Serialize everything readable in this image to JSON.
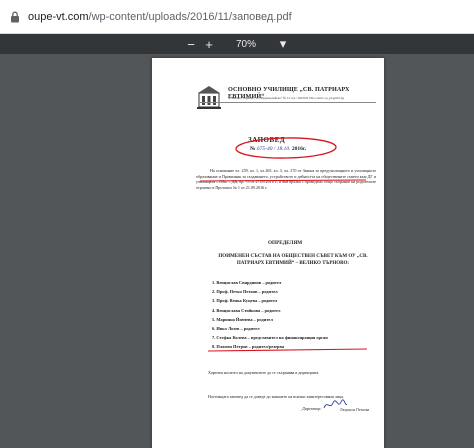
{
  "browser": {
    "url_host": "oupe-vt.com",
    "url_path": "/wp-content/uploads/2016/11/заповед.pdf"
  },
  "toolbar": {
    "minus_label": "−",
    "plus_label": "+",
    "zoom_value": "70%",
    "chevron_label": "▾"
  },
  "document": {
    "school_name": "ОСНОВНО УЧИЛИЩЕ „СВ. ПАТРИАРХ ЕВТИМИЙ“",
    "school_address": "гр.Велико Търново, ул.„Мармарлийска“ № 12 тел.: 062/620 036 e-mail: ou_ptr@abv.bg",
    "title": "ЗАПОВЕД",
    "number_prefix": "№",
    "number_handwritten": "675-40 / 18.10.",
    "number_suffix": "2016г.",
    "paragraph1": "На основание чл. 259, ал. 1, чл.265, ал. 3, чл. 270 от Закона за предучилищното и училищното образование и Правилник за създаването, устройството и дейността на обществените съвети към ДГ и училищата – Обн. – ДВ, бр. 75 от 27.09.2016 г., и във връзка с проведено общо събрание на родителите отразено в Протокол № 1 от 21.09.2016 г.",
    "determine": "ОПРЕДЕЛЯМ",
    "heading": "ПОИМЕНЕН СЪСТАВ НА ОБЩЕСТВЕН СЪВЕТ КЪМ ОУ „СВ. ПАТРИАРХ ЕВТИМИЙ“ – ВЕЛИКО ТЪРНОВО:",
    "members": [
      "1. Венцислав Свирдинов – родител",
      "2. Проф. Петко Петков – родител",
      "3. Проф. Венка Куцева – родител",
      "4. Венцислава Стойкова – родител",
      "5. Марияна Йовчева – родител",
      "6. Ивко Лозев – родител",
      "7. Стефка Колева – представител на финансиращия орган",
      "8. Пламен Петров – родител/резерва"
    ],
    "paragraph2": "Хартиен носител на документите да се съхранява в дирекцията.",
    "paragraph3": "Настоящата заповед да се доведе до знанието на всички заинтересовани лица.",
    "director_label": "Директор:",
    "director_name": "Людмила Петкова"
  },
  "colors": {
    "annotation_red": "#d8141c",
    "viewer_bg": "#525659",
    "toolbar_bg": "#323639"
  },
  "icons": {
    "address_bar": "lock-icon",
    "crest": "school-crest-icon"
  }
}
